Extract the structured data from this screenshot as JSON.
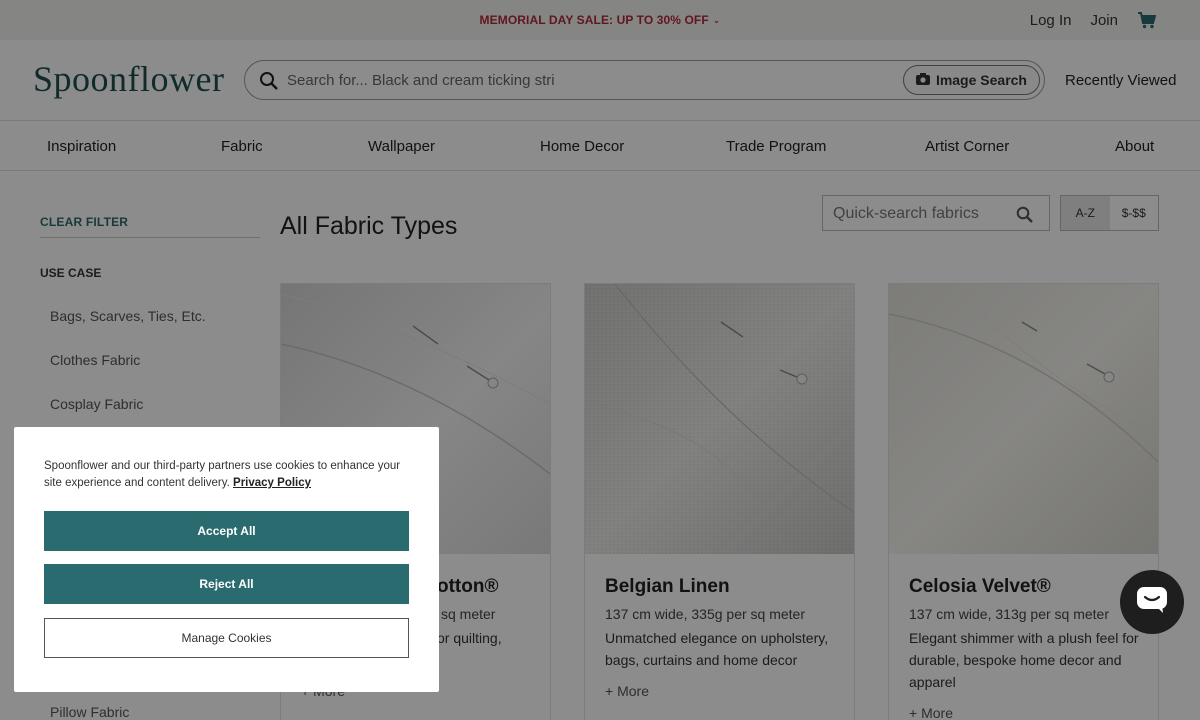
{
  "promo": {
    "text": "MEMORIAL DAY SALE: UP TO 30% OFF",
    "chevron": "⌄"
  },
  "top_links": {
    "login": "Log In",
    "join": "Join",
    "cart_icon": "cart-icon"
  },
  "header": {
    "logo": "Spoonflower",
    "search_placeholder": "Search for... Black and cream ticking stri",
    "image_search": "Image Search",
    "recently_viewed": "Recently Viewed"
  },
  "nav": [
    "Inspiration",
    "Fabric",
    "Wallpaper",
    "Home Decor",
    "Trade Program",
    "Artist Corner",
    "About"
  ],
  "sidebar": {
    "clear_filter": "CLEAR FILTER",
    "use_case": "USE CASE",
    "items": [
      "Bags, Scarves, Ties, Etc.",
      "Clothes Fabric",
      "Cosplay Fabric",
      "Pillow Fabric"
    ]
  },
  "main": {
    "title": "All Fabric Types",
    "quick_search_placeholder": "Quick-search fabrics",
    "sort": [
      "A-Z",
      "$-$$"
    ],
    "cards": [
      {
        "title": "otton®",
        "spec": "sq meter",
        "desc": "or quilting,",
        "more": "More"
      },
      {
        "title": "Belgian Linen",
        "spec": "137 cm wide, 335g per sq meter",
        "desc": "Unmatched elegance on upholstery, bags, curtains and home decor",
        "more": "More"
      },
      {
        "title": "Celosia Velvet®",
        "spec": "137 cm wide, 313g per sq meter",
        "desc": "Elegant shimmer with a plush feel for durable, bespoke home decor and apparel",
        "more": "More"
      }
    ]
  },
  "cookie": {
    "text": "Spoonflower and our third-party partners use cookies to enhance your site experience and content delivery.",
    "privacy": "Privacy Policy",
    "accept": "Accept All",
    "reject": "Reject All",
    "manage": "Manage Cookies"
  },
  "colors": {
    "brand": "#2a6b70",
    "promo": "#b02a3a",
    "logo": "#1f4f52"
  }
}
